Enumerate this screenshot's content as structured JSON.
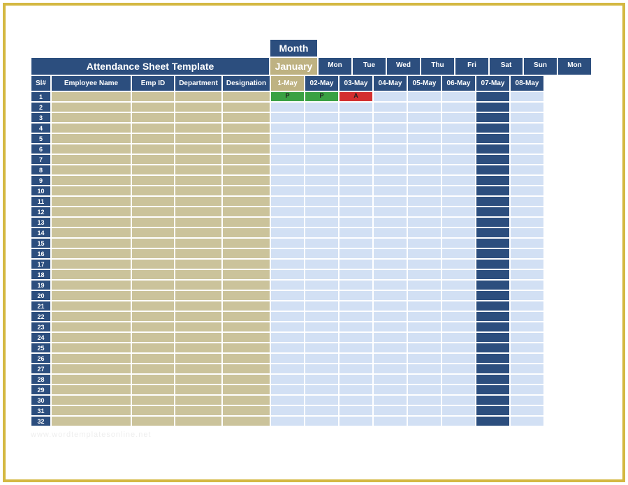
{
  "month_label": "Month",
  "title": "Attendance Sheet Template",
  "month_value": "January",
  "headers": {
    "sl": "Sl#",
    "name": "Employee Name",
    "empid": "Emp ID",
    "dept": "Department",
    "desig": "Designation"
  },
  "days_of_week": [
    "Mon",
    "Tue",
    "Wed",
    "Thu",
    "Fri",
    "Sat",
    "Sun",
    "Mon"
  ],
  "dates": [
    "1-May",
    "02-May",
    "03-May",
    "04-May",
    "05-May",
    "06-May",
    "07-May",
    "08-May"
  ],
  "sunday_index": 6,
  "row_count": 32,
  "attendance": {
    "1": {
      "0": "P",
      "1": "P",
      "2": "A"
    }
  },
  "watermark": "www.wordtemplatesonline.net"
}
